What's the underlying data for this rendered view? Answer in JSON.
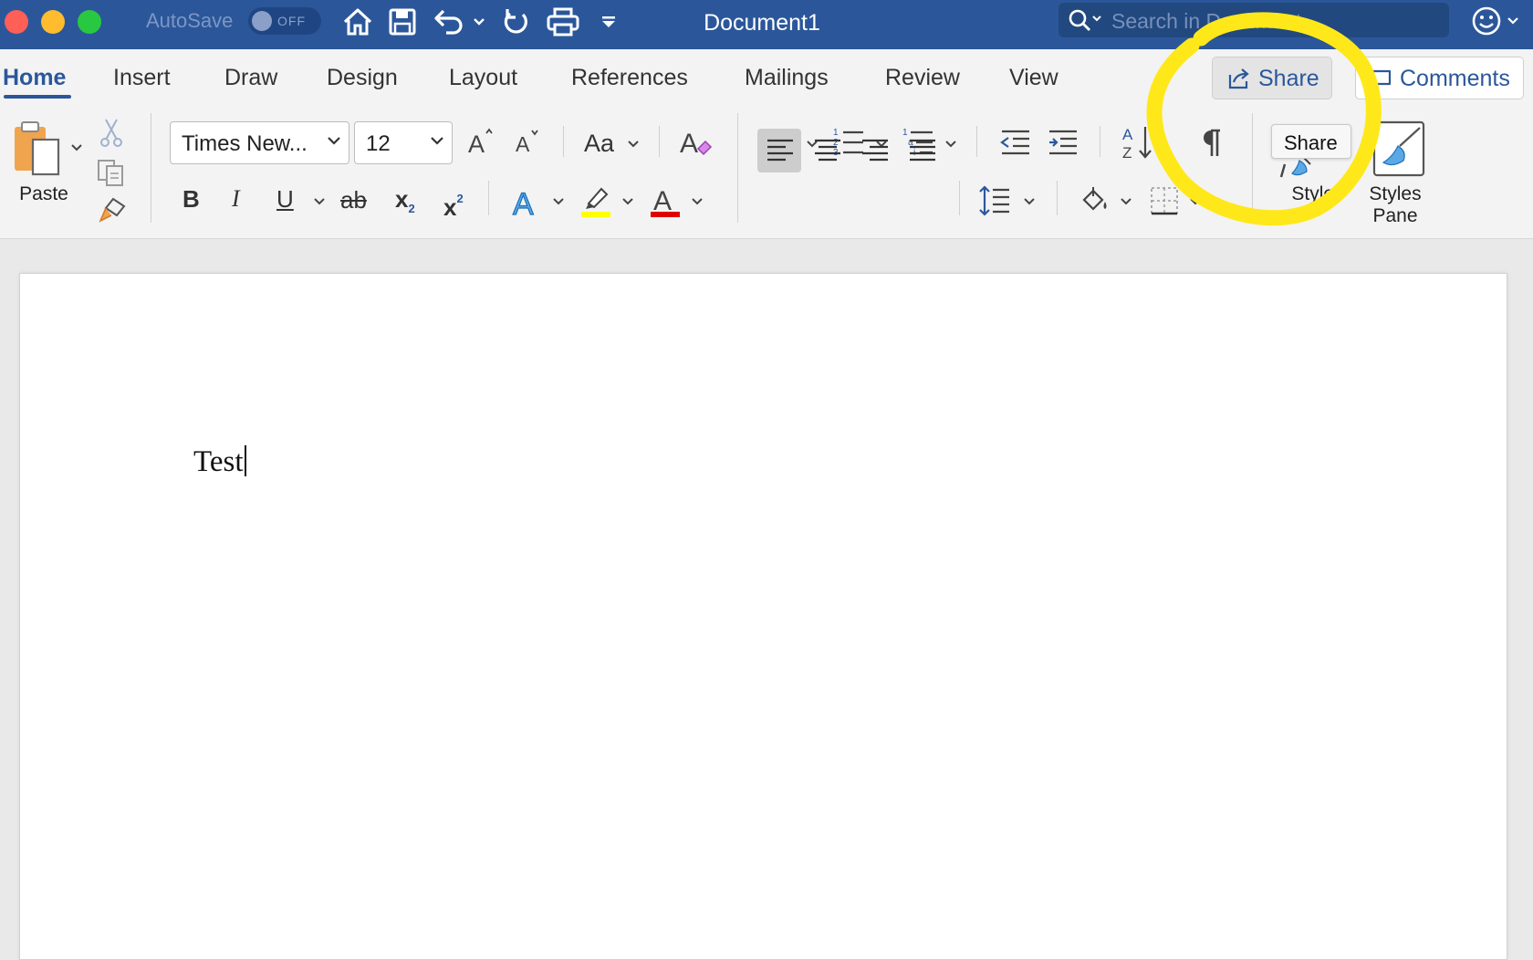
{
  "titlebar": {
    "autosave_label": "AutoSave",
    "autosave_state": "OFF",
    "document_title": "Document1",
    "search_placeholder": "Search in Document"
  },
  "ribbon": {
    "tabs": [
      {
        "label": "Home",
        "active": true
      },
      {
        "label": "Insert"
      },
      {
        "label": "Draw"
      },
      {
        "label": "Design"
      },
      {
        "label": "Layout"
      },
      {
        "label": "References"
      },
      {
        "label": "Mailings"
      },
      {
        "label": "Review"
      },
      {
        "label": "View"
      }
    ],
    "share_label": "Share",
    "comments_label": "Comments",
    "paste_label": "Paste",
    "font_name": "Times New...",
    "font_size": "12",
    "case_label": "Aa",
    "bold": "B",
    "italic": "I",
    "underline": "U",
    "strikethrough": "ab",
    "subscript": "x",
    "superscript": "x",
    "styles_label": "Styles",
    "styles_pane_label": "Styles Pane",
    "share_tooltip": "Share"
  },
  "document": {
    "body_text": "Test"
  },
  "colors": {
    "accent": "#2b579a",
    "highlight": "#ffff00",
    "font_color": "#e00000",
    "annotation": "#ffe81a"
  }
}
